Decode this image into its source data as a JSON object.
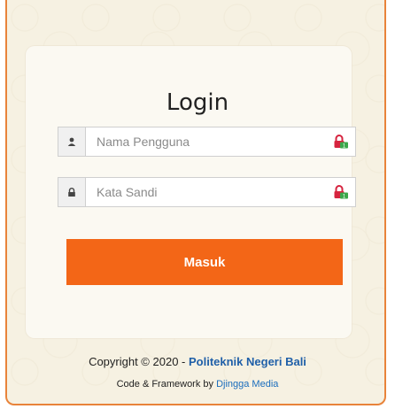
{
  "login": {
    "title": "Login",
    "username_placeholder": "Nama Pengguna",
    "password_placeholder": "Kata Sandi",
    "submit_label": "Masuk"
  },
  "footer": {
    "copyright_prefix": "Copyright © 2020 - ",
    "copyright_link": "Politeknik Negeri Bali",
    "credits_prefix": "Code & Framework by ",
    "credits_link": "Djingga Media"
  },
  "icons": {
    "username_addon": "user-icon",
    "password_addon": "lock-icon",
    "password_manager": "keepass-icon"
  },
  "colors": {
    "accent": "#f36617",
    "border": "#e8833a",
    "link": "#1f5fa8"
  }
}
